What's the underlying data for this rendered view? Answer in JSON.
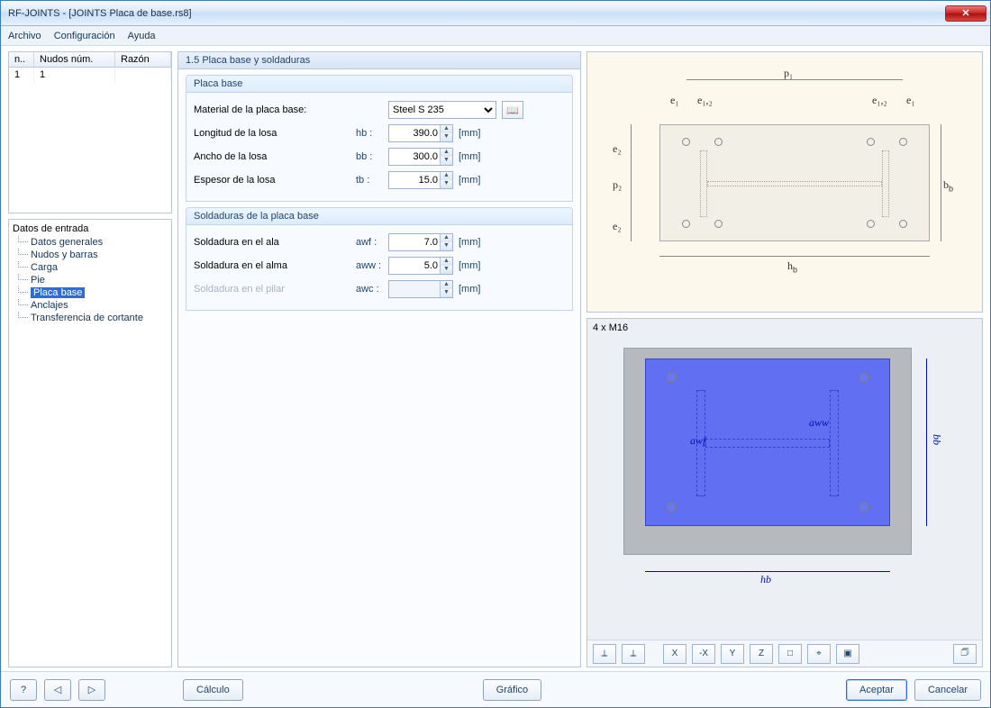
{
  "window": {
    "title": "RF-JOINTS - [JOINTS Placa de base.rs8]"
  },
  "menu": {
    "file": "Archivo",
    "config": "Configuración",
    "help": "Ayuda"
  },
  "left": {
    "grid_headers": {
      "c1": "n..",
      "c2": "Nudos núm.",
      "c3": "Razón"
    },
    "grid_row": {
      "c1": "1",
      "c2": "1",
      "c3": ""
    },
    "tree_root": "Datos de entrada",
    "tree_items": [
      "Datos generales",
      "Nudos y barras",
      "Carga",
      "Pie",
      "Placa base",
      "Anclajes",
      "Transferencia de cortante"
    ]
  },
  "center": {
    "title": "1.5 Placa base y soldaduras",
    "group1_title": "Placa base",
    "material_label": "Material de la placa base:",
    "material_value": "Steel S 235",
    "rows1": [
      {
        "label": "Longitud de la losa",
        "sym": "hb :",
        "value": "390.0",
        "unit": "[mm]"
      },
      {
        "label": "Ancho de la losa",
        "sym": "bb :",
        "value": "300.0",
        "unit": "[mm]"
      },
      {
        "label": "Espesor de la losa",
        "sym": "tb :",
        "value": "15.0",
        "unit": "[mm]"
      }
    ],
    "group2_title": "Soldaduras de la placa base",
    "rows2": [
      {
        "label": "Soldadura en el ala",
        "sym": "awf :",
        "value": "7.0",
        "unit": "[mm]",
        "disabled": false
      },
      {
        "label": "Soldadura en el alma",
        "sym": "aww :",
        "value": "5.0",
        "unit": "[mm]",
        "disabled": false
      },
      {
        "label": "Soldadura en el pilar",
        "sym": "awc :",
        "value": "",
        "unit": "[mm]",
        "disabled": true
      }
    ]
  },
  "diagram_labels": {
    "p1": "p₁",
    "e1": "e₁",
    "e12": "e₁,₂",
    "e2": "e₂",
    "p2": "p₂",
    "hb": "hb",
    "bb": "bb"
  },
  "preview": {
    "label": "4 x M16",
    "awf": "awf",
    "aww": "aww",
    "hb": "hb",
    "bb": "bb"
  },
  "toolbar": {
    "b1": "⟂",
    "b2": "⟂",
    "b3": "X",
    "b4": "-X",
    "b5": "Y",
    "b6": "Z",
    "b7": "□",
    "b8": "⌖",
    "b9": "▣",
    "print": "🗇"
  },
  "footer": {
    "help": "?",
    "nav1": "◁",
    "nav2": "▷",
    "calc": "Cálculo",
    "graphic": "Gráfico",
    "accept": "Aceptar",
    "cancel": "Cancelar"
  }
}
